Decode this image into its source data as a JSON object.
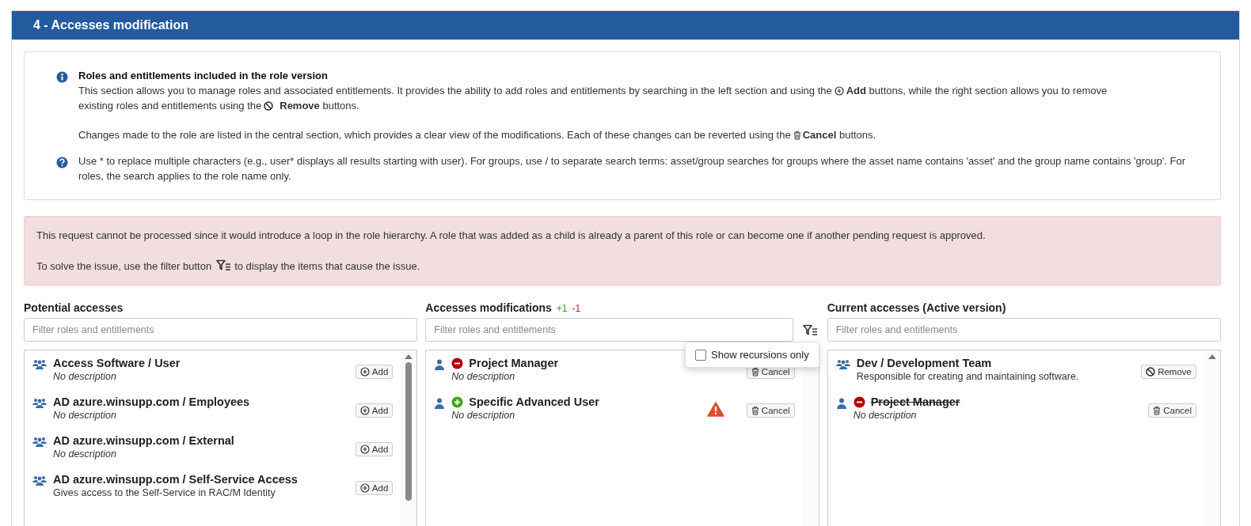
{
  "panel": {
    "title": "4 - Accesses modification"
  },
  "info": {
    "heading": "Roles and entitlements included in the role version",
    "paragraphs": [
      [
        {
          "kind": "text",
          "text": "This section allows you to manage roles and associated entitlements. It provides the ability to add roles and entitlements by searching in the left section and using the"
        },
        {
          "kind": "add"
        },
        {
          "kind": "text",
          "text": "**Add** buttons, while the right section allows you to remove"
        },
        {
          "kind": "break"
        },
        {
          "kind": "text",
          "text": "existing roles and entitlements using the"
        },
        {
          "kind": "remove"
        },
        {
          "kind": "text",
          "text": "**Remove** buttons."
        }
      ],
      [
        {
          "kind": "text",
          "text": "Changes made to the role are listed in the central section, which provides a clear view of the modifications. Each of these changes can be reverted using the"
        },
        {
          "kind": "cancel"
        },
        {
          "kind": "text",
          "text": "**Cancel** buttons."
        }
      ]
    ],
    "help": "Use * to replace multiple characters (e.g., user* displays all results starting with user). For groups, use / to separate search terms: asset/group searches for groups where the asset name contains 'asset' and the group name contains 'group'. For roles, the search applies to the role name only."
  },
  "alert": {
    "paragraphs": [
      [
        {
          "kind": "text",
          "text": "This request cannot be processed since it would introduce a loop in the role hierarchy. A role that was added as a child is already a parent of this role or can become one if another pending request is approved."
        }
      ],
      [
        {
          "kind": "text",
          "text": "To solve the issue, use the filter button"
        },
        {
          "kind": "filter"
        },
        {
          "kind": "text",
          "text": "to display the items that cause the issue."
        }
      ]
    ]
  },
  "columns": [
    {
      "title": "Potential accesses",
      "filter_placeholder": "Filter roles and entitlements",
      "filter_button": false,
      "scrollbar": {
        "kind": "thumb"
      },
      "items": [
        {
          "kind": "group",
          "struck": false,
          "name": "Access Software / User",
          "description": "No description",
          "description_missing": true,
          "button": {
            "kind": "add",
            "label": "Add"
          },
          "warning": false
        },
        {
          "kind": "group",
          "struck": false,
          "name": "AD azure.winsupp.com / Employees",
          "description": "No description",
          "description_missing": true,
          "button": {
            "kind": "add",
            "label": "Add"
          },
          "warning": false
        },
        {
          "kind": "group",
          "struck": false,
          "name": "AD azure.winsupp.com / External",
          "description": "No description",
          "description_missing": true,
          "button": {
            "kind": "add",
            "label": "Add"
          },
          "warning": false
        },
        {
          "kind": "group",
          "struck": false,
          "name": "AD azure.winsupp.com / Self-Service Access",
          "description": "Gives access to the Self-Service in RAC/M Identity",
          "description_missing": false,
          "button": {
            "kind": "add",
            "label": "Add"
          },
          "warning": false
        }
      ]
    },
    {
      "title": "Accesses modifications",
      "added_count": "+1",
      "removed_count": "-1",
      "filter_placeholder": "Filter roles and entitlements",
      "filter_button": true,
      "popover": {
        "label": "Show recursions only",
        "checked": false
      },
      "scrollbar": {
        "kind": "track"
      },
      "items": [
        {
          "kind": "user",
          "change": {
            "kind": "removed"
          },
          "struck": false,
          "name": "Project Manager",
          "description": "No description",
          "description_missing": true,
          "button": {
            "kind": "cancel",
            "label": "Cancel"
          },
          "warning": false
        },
        {
          "kind": "user",
          "change": {
            "kind": "added"
          },
          "struck": false,
          "name": "Specific Advanced User",
          "description": "No description",
          "description_missing": true,
          "button": {
            "kind": "cancel",
            "label": "Cancel"
          },
          "warning": true
        }
      ]
    },
    {
      "title": "Current accesses (Active version)",
      "filter_placeholder": "Filter roles and entitlements",
      "filter_button": false,
      "scrollbar": {
        "kind": "arrow"
      },
      "items": [
        {
          "kind": "group",
          "struck": false,
          "name": "Dev / Development Team",
          "description": "Responsible for creating and maintaining software.",
          "description_missing": false,
          "button": {
            "kind": "remove",
            "label": "Remove"
          },
          "warning": false
        },
        {
          "kind": "user",
          "change": {
            "kind": "removed"
          },
          "struck": true,
          "name": "Project Manager",
          "description": "No description",
          "description_missing": true,
          "button": {
            "kind": "cancel",
            "label": "Cancel"
          },
          "warning": false
        }
      ]
    }
  ]
}
